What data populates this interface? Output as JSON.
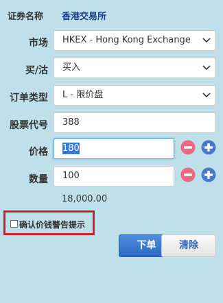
{
  "form": {
    "exchange_label": "证券名称",
    "exchange_value": "香港交易所",
    "market": {
      "label": "市场",
      "selected": "HKEX - Hong Kong Exchange"
    },
    "side": {
      "label": "买/沽",
      "selected": "买入"
    },
    "order_type": {
      "label": "订单类型",
      "selected": "L - 限价盘"
    },
    "stock_code": {
      "label": "股票代号",
      "value": "388"
    },
    "price": {
      "label": "价格",
      "value": "180"
    },
    "quantity": {
      "label": "数量",
      "value": "100"
    },
    "total": "18,000.00",
    "confirm_label": "确认价钱警告提示",
    "submit_label": "下单",
    "clear_label": "清除"
  },
  "icons": {
    "minus": "minus-circle-icon",
    "plus": "plus-circle-icon",
    "caret": "chevron-down-icon"
  },
  "colors": {
    "background": "#bfe0ea",
    "minus": "#e86b80",
    "plus": "#4a79c9",
    "warning_border": "#d81e1e",
    "submit": "#2b68c2",
    "exchange_value": "#1a3d8c"
  }
}
